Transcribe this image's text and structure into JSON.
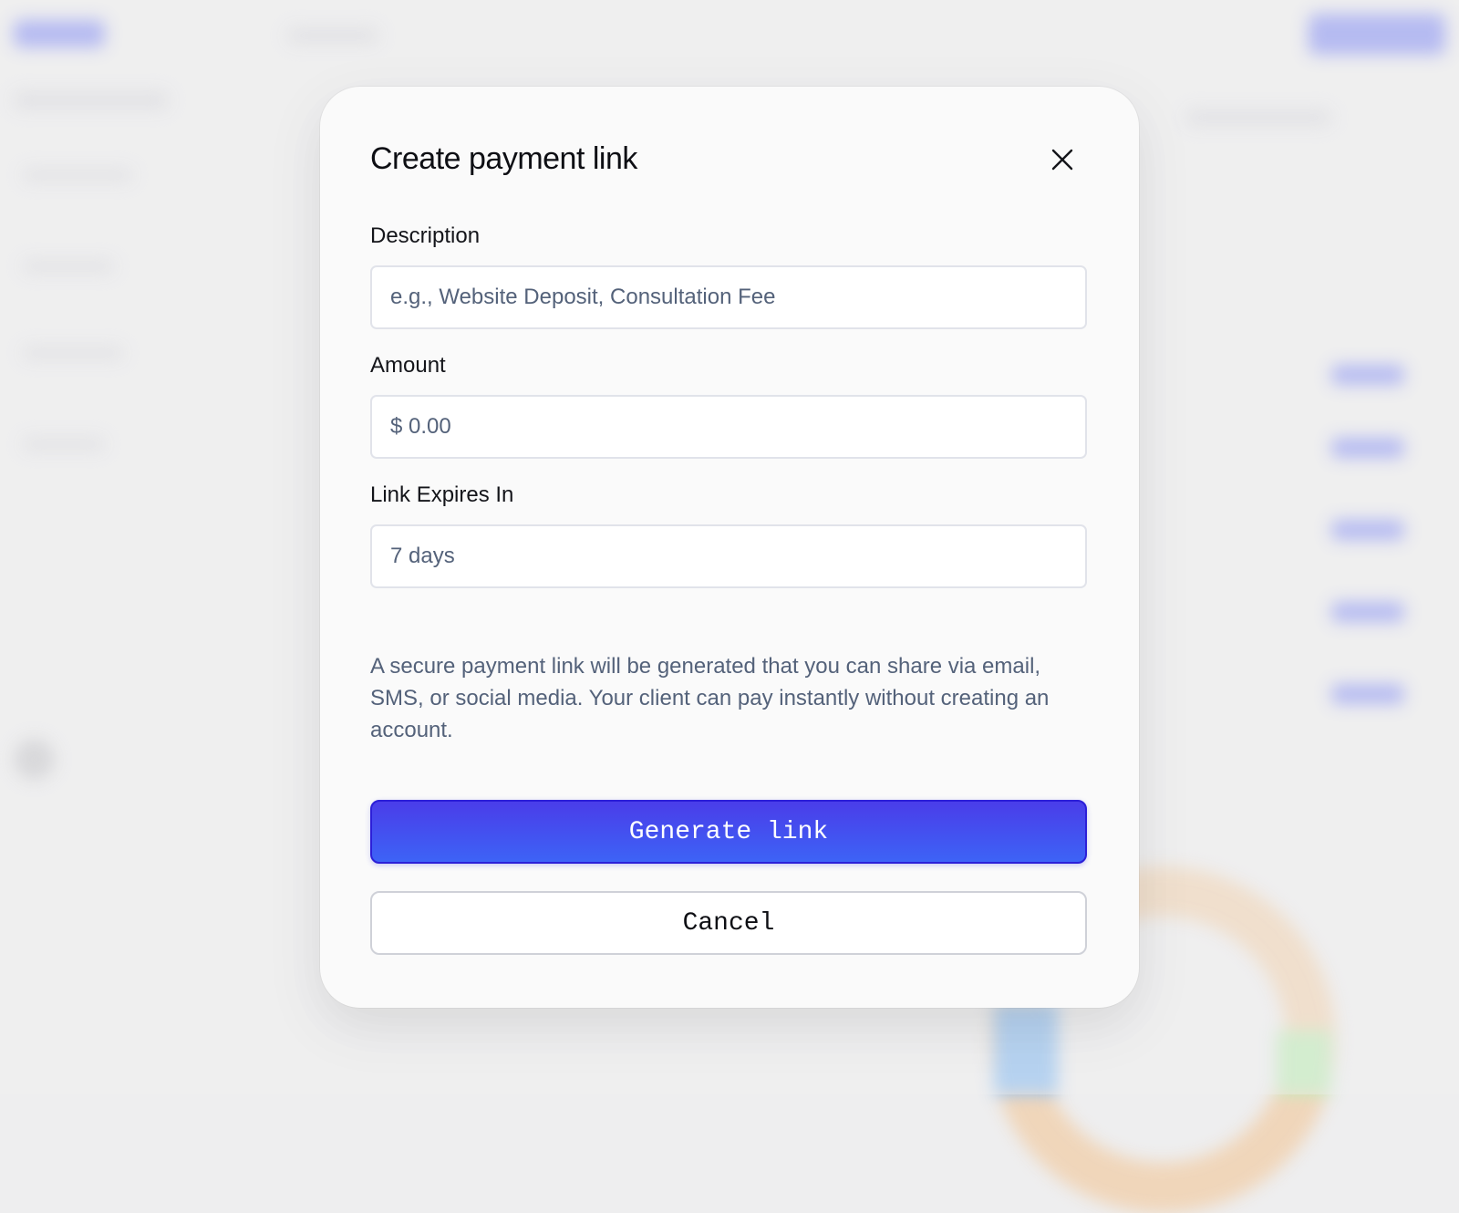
{
  "modal": {
    "title": "Create payment link",
    "close_icon": "close-icon",
    "description": {
      "label": "Description",
      "value": "",
      "placeholder": "e.g., Website Deposit, Consultation Fee"
    },
    "amount": {
      "label": "Amount",
      "value": "",
      "placeholder": "$ 0.00"
    },
    "expires": {
      "label": "Link Expires In",
      "value": "7 days"
    },
    "note": "A secure payment link will be generated that you can share via email, SMS, or social media. Your client can pay instantly without creating an account.",
    "generate_label": "Generate link",
    "cancel_label": "Cancel"
  },
  "colors": {
    "primary_gradient_start": "#4a3de9",
    "primary_gradient_end": "#3d63f6",
    "muted_text": "#54627a"
  }
}
